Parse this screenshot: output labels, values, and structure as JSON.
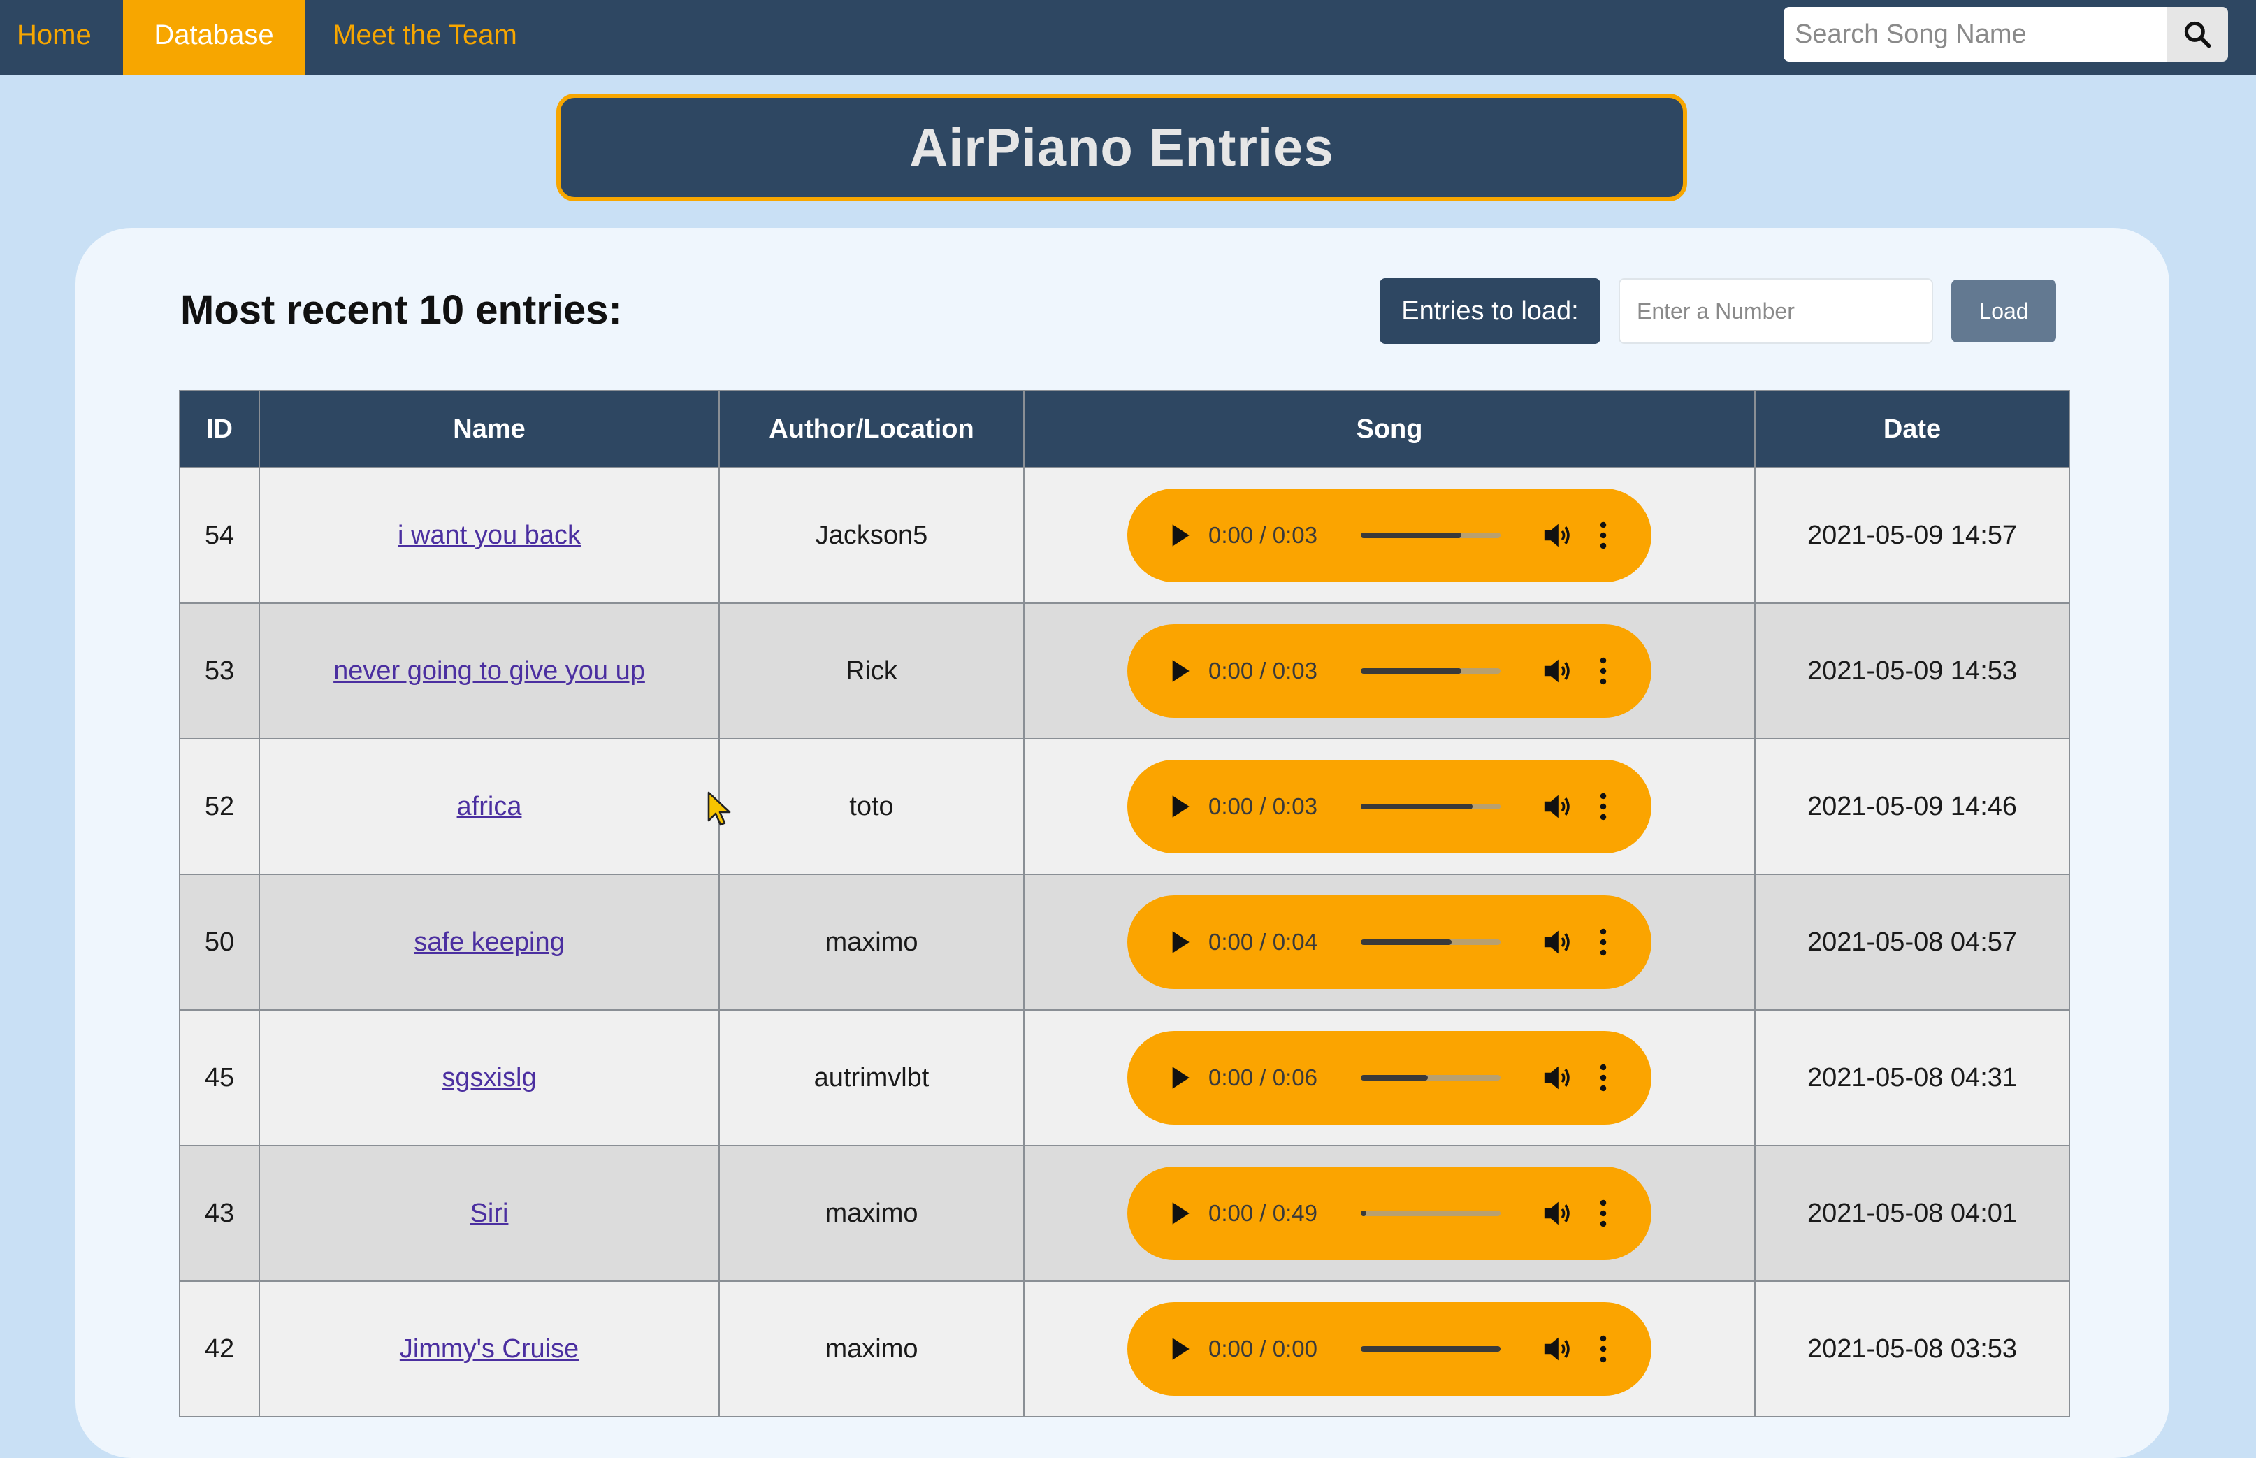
{
  "nav": {
    "items": [
      {
        "label": "Home"
      },
      {
        "label": "Database",
        "active": true
      },
      {
        "label": "Meet the Team"
      }
    ],
    "search_placeholder": "Search Song Name",
    "search_icon": "search-icon"
  },
  "banner": {
    "title": "AirPiano Entries"
  },
  "controls": {
    "heading": "Most recent 10 entries:",
    "entries_label": "Entries to load:",
    "entries_placeholder": "Enter a Number",
    "load_label": "Load"
  },
  "table": {
    "columns": [
      "ID",
      "Name",
      "Author/Location",
      "Song",
      "Date"
    ],
    "rows": [
      {
        "id": "54",
        "name": "i want you back",
        "author": "Jackson5",
        "time": "0:00 / 0:03",
        "volume": 0.72,
        "date": "2021-05-09 14:57"
      },
      {
        "id": "53",
        "name": "never going to give you up",
        "author": "Rick",
        "time": "0:00 / 0:03",
        "volume": 0.72,
        "date": "2021-05-09 14:53"
      },
      {
        "id": "52",
        "name": "africa",
        "author": "toto",
        "time": "0:00 / 0:03",
        "volume": 0.8,
        "date": "2021-05-09 14:46"
      },
      {
        "id": "50",
        "name": "safe keeping",
        "author": "maximo",
        "time": "0:00 / 0:04",
        "volume": 0.65,
        "date": "2021-05-08 04:57"
      },
      {
        "id": "45",
        "name": "sgsxislg",
        "author": "autrimvlbt",
        "time": "0:00 / 0:06",
        "volume": 0.48,
        "date": "2021-05-08 04:31"
      },
      {
        "id": "43",
        "name": "Siri",
        "author": "maximo",
        "time": "0:00 / 0:49",
        "volume": 0.04,
        "date": "2021-05-08 04:01"
      },
      {
        "id": "42",
        "name": "Jimmy's Cruise",
        "author": "maximo",
        "time": "0:00 / 0:00",
        "volume": 1.0,
        "date": "2021-05-08 03:53"
      }
    ]
  },
  "colors": {
    "navy": "#2e4762",
    "accent_orange": "#f7a600",
    "player_orange": "#fba400",
    "page_bg": "#c9e0f5"
  }
}
